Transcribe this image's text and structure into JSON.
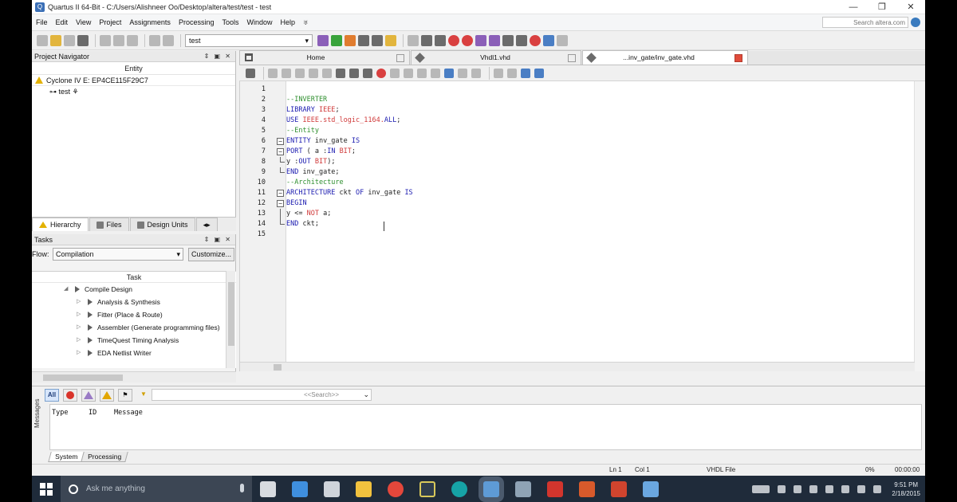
{
  "window": {
    "title": "Quartus II 64-Bit - C:/Users/Alishneer Oo/Desktop/altera/test/test - test",
    "controls": [
      "—",
      "❐",
      "✕"
    ]
  },
  "menu": [
    "File",
    "Edit",
    "View",
    "Project",
    "Assignments",
    "Processing",
    "Tools",
    "Window",
    "Help"
  ],
  "search": {
    "placeholder": "Search altera.com"
  },
  "toolbar": {
    "project_value": "test"
  },
  "project_navigator": {
    "title": "Project Navigator",
    "column": "Entity",
    "device": "Cyclone IV E: EP4CE115F29C7",
    "entity": "test",
    "tabs": [
      "Hierarchy",
      "Files",
      "Design Units"
    ]
  },
  "tasks": {
    "title": "Tasks",
    "flow_label": "Flow:",
    "flow_value": "Compilation",
    "customize_label": "Customize...",
    "column": "Task",
    "items": [
      "Compile Design",
      "Analysis & Synthesis",
      "Fitter (Place & Route)",
      "Assembler (Generate programming files)",
      "TimeQuest Timing Analysis",
      "EDA Netlist Writer"
    ]
  },
  "editor_tabs": [
    {
      "label": "Home"
    },
    {
      "label": "Vhdl1.vhd"
    },
    {
      "label": "...inv_gate/inv_gate.vhd"
    }
  ],
  "code": {
    "lines": [
      {
        "n": "1",
        "parts": []
      },
      {
        "n": "2",
        "parts": [
          {
            "t": "--INVERTER",
            "c": "c-comment"
          }
        ]
      },
      {
        "n": "3",
        "parts": [
          {
            "t": "LIBRARY ",
            "c": "c-kw"
          },
          {
            "t": "IEEE",
            "c": "c-lib"
          },
          {
            "t": ";",
            "c": "c-id"
          }
        ]
      },
      {
        "n": "4",
        "parts": [
          {
            "t": "USE ",
            "c": "c-kw"
          },
          {
            "t": "IEEE.std_logic_1164.",
            "c": "c-lib"
          },
          {
            "t": "ALL",
            "c": "c-kw"
          },
          {
            "t": ";",
            "c": "c-id"
          }
        ]
      },
      {
        "n": "5",
        "parts": [
          {
            "t": "--Entity",
            "c": "c-comment"
          }
        ]
      },
      {
        "n": "6",
        "parts": [
          {
            "t": "ENTITY ",
            "c": "c-kw"
          },
          {
            "t": "inv_gate ",
            "c": "c-id"
          },
          {
            "t": "IS",
            "c": "c-kw"
          }
        ]
      },
      {
        "n": "7",
        "parts": [
          {
            "t": "PORT",
            "c": "c-kw"
          },
          {
            "t": " ( a :",
            "c": "c-id"
          },
          {
            "t": "IN ",
            "c": "c-kw"
          },
          {
            "t": "BIT",
            "c": "c-lib"
          },
          {
            "t": ";",
            "c": "c-id"
          }
        ]
      },
      {
        "n": "8",
        "parts": [
          {
            "t": "y :",
            "c": "c-id"
          },
          {
            "t": "OUT ",
            "c": "c-kw"
          },
          {
            "t": "BIT",
            "c": "c-lib"
          },
          {
            "t": ");",
            "c": "c-id"
          }
        ]
      },
      {
        "n": "9",
        "parts": [
          {
            "t": "END ",
            "c": "c-kw"
          },
          {
            "t": "inv_gate;",
            "c": "c-id"
          }
        ]
      },
      {
        "n": "10",
        "parts": [
          {
            "t": "--Architecture",
            "c": "c-comment"
          }
        ]
      },
      {
        "n": "11",
        "parts": [
          {
            "t": "ARCHITECTURE ",
            "c": "c-kw"
          },
          {
            "t": "ckt ",
            "c": "c-id"
          },
          {
            "t": "OF ",
            "c": "c-kw"
          },
          {
            "t": "inv_gate ",
            "c": "c-id"
          },
          {
            "t": "IS",
            "c": "c-kw"
          }
        ]
      },
      {
        "n": "12",
        "parts": [
          {
            "t": "BEGIN",
            "c": "c-kw"
          }
        ]
      },
      {
        "n": "13",
        "parts": [
          {
            "t": "y <= ",
            "c": "c-id"
          },
          {
            "t": "NOT ",
            "c": "c-lib"
          },
          {
            "t": "a;",
            "c": "c-id"
          }
        ]
      },
      {
        "n": "14",
        "parts": [
          {
            "t": "END ",
            "c": "c-kw"
          },
          {
            "t": "ckt;",
            "c": "c-id"
          }
        ]
      },
      {
        "n": "15",
        "parts": []
      }
    ]
  },
  "messages": {
    "side_label": "Messages",
    "all_label": "All",
    "search_placeholder": "<<Search>>",
    "columns": [
      "Type",
      "ID",
      "Message"
    ],
    "tabs": [
      "System",
      "Processing"
    ]
  },
  "status": {
    "ln": "Ln 1",
    "col": "Col 1",
    "filetype": "VHDL File",
    "progress": "0%",
    "elapsed": "00:00:00"
  },
  "taskbar": {
    "search_placeholder": "Ask me anything",
    "time": "9:51 PM",
    "date": "2/18/2015"
  }
}
